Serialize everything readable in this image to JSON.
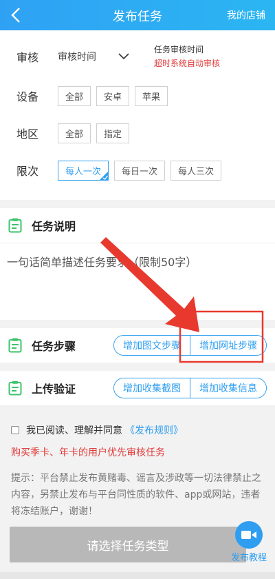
{
  "header": {
    "title": "发布任务",
    "right_link": "我的店铺"
  },
  "form": {
    "review": {
      "label": "审核",
      "value": "审核时间",
      "note_line1": "任务审核时间",
      "note_line2": "超时系统自动审核"
    },
    "device": {
      "label": "设备",
      "options": [
        "全部",
        "安卓",
        "苹果"
      ]
    },
    "region": {
      "label": "地区",
      "options": [
        "全部",
        "指定"
      ]
    },
    "limit": {
      "label": "限次",
      "options": [
        "每人一次",
        "每日一次",
        "每人三次"
      ],
      "selected": "每人一次"
    }
  },
  "description": {
    "title": "任务说明",
    "placeholder": "一句话简单描述任务要求（限制50字）"
  },
  "steps": {
    "title": "任务步骤",
    "buttons": [
      "增加图文步骤",
      "增加网址步骤"
    ]
  },
  "upload": {
    "title": "上传验证",
    "buttons": [
      "增加收集截图",
      "增加收集信息"
    ]
  },
  "agreement": {
    "text": "我已阅读、理解并同意",
    "link": "《发布规则》"
  },
  "promo": "购买季卡、年卡的用户优先审核任务",
  "notice": "提示：平台禁止发布黄赌毒、谣言及涉政等一切法律禁止之内容，另禁止发布与平台同性质的软件、app或网站，违者将冻结账户，谢谢！",
  "submit_label": "请选择任务类型",
  "tutorial_label": "发布教程",
  "colors": {
    "accent": "#2f9ef0",
    "warning": "#e13a3a",
    "annotation": "#e8392f"
  }
}
